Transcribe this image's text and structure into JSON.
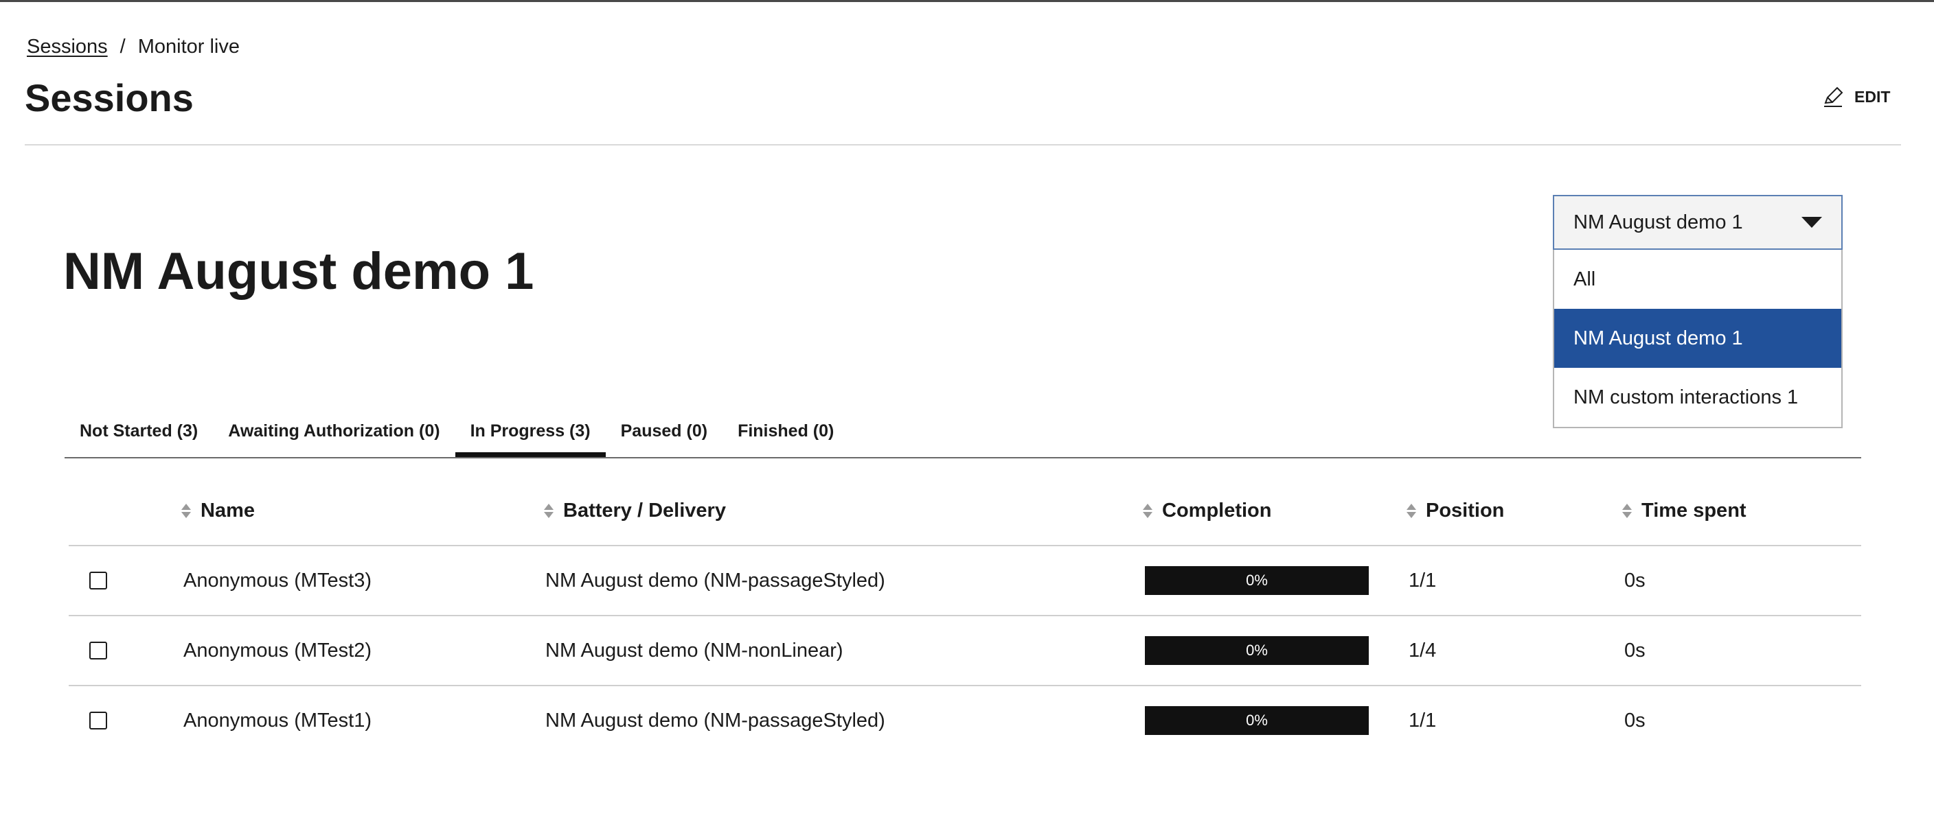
{
  "breadcrumb": {
    "link": "Sessions",
    "separator": "/",
    "current": "Monitor live"
  },
  "page_title": "Sessions",
  "edit_label": "EDIT",
  "delivery_title": "NM August demo 1",
  "delivery_select": {
    "selected": "NM August demo 1",
    "options": [
      "All",
      "NM August demo 1",
      "NM custom interactions 1"
    ],
    "expanded": true
  },
  "tabs": [
    {
      "label": "Not Started (3)",
      "active": false
    },
    {
      "label": "Awaiting Authorization (0)",
      "active": false
    },
    {
      "label": "In Progress (3)",
      "active": true
    },
    {
      "label": "Paused (0)",
      "active": false
    },
    {
      "label": "Finished (0)",
      "active": false
    }
  ],
  "table": {
    "headers": [
      "Name",
      "Battery / Delivery",
      "Completion",
      "Position",
      "Time spent"
    ],
    "rows": [
      {
        "name": "Anonymous (MTest3)",
        "delivery": "NM August demo (NM-passageStyled)",
        "completion": "0%",
        "completion_value": 0,
        "position": "1/1",
        "time_spent": "0s"
      },
      {
        "name": "Anonymous (MTest2)",
        "delivery": "NM August demo (NM-nonLinear)",
        "completion": "0%",
        "completion_value": 0,
        "position": "1/4",
        "time_spent": "0s"
      },
      {
        "name": "Anonymous (MTest1)",
        "delivery": "NM August demo (NM-passageStyled)",
        "completion": "0%",
        "completion_value": 0,
        "position": "1/1",
        "time_spent": "0s"
      }
    ]
  },
  "colors": {
    "accent": "#21519a",
    "progress_bg": "#111111",
    "select_border": "#5b7fb3"
  },
  "icons": {
    "edit": "pencil-icon",
    "sort": "sort-icon",
    "dropdown": "caret-down-icon"
  }
}
